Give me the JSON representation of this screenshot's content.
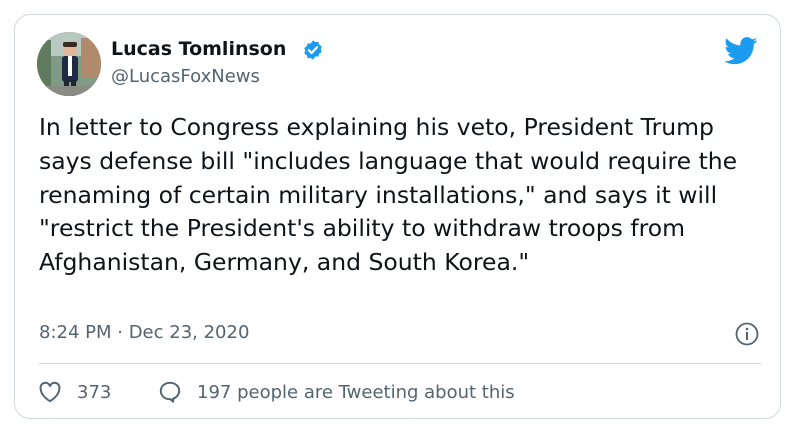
{
  "author": {
    "display_name": "Lucas Tomlinson",
    "handle": "@LucasFoxNews",
    "verified": true,
    "avatar_icon": "profile-photo"
  },
  "tweet": {
    "text": "In letter to Congress explaining his veto, President Trump says defense bill \"includes language that would require the renaming of certain military installations,\" and says it will \"restrict the President's ability to withdraw troops from Afghanistan, Germany, and South Korea.\"",
    "timestamp": "8:24 PM · Dec 23, 2020"
  },
  "engagement": {
    "likes": "373",
    "tweeting": "197 people are Tweeting about this"
  },
  "icons": {
    "brand": "twitter-bird-icon",
    "verified": "verified-badge-icon",
    "info": "info-icon",
    "like": "heart-icon",
    "reply": "speech-bubble-icon"
  },
  "colors": {
    "brand": "#1d9bf0",
    "text_primary": "#0f1419",
    "text_secondary": "#536471",
    "border": "#cfd9de"
  }
}
